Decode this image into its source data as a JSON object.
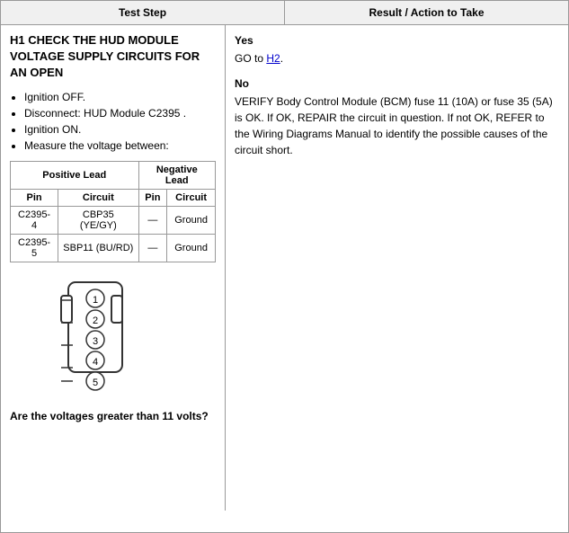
{
  "header": {
    "col1": "Test Step",
    "col2": "Result / Action to Take"
  },
  "step": {
    "title": "H1 CHECK THE HUD MODULE VOLTAGE SUPPLY CIRCUITS FOR AN OPEN",
    "bullets": [
      "Ignition OFF.",
      "Disconnect: HUD Module C2395 .",
      "Ignition ON.",
      "Measure the voltage between:"
    ],
    "table": {
      "pos_header": "Positive Lead",
      "neg_header": "Negative Lead",
      "sub_headers": [
        "Pin",
        "Circuit",
        "Pin",
        "Circuit"
      ],
      "rows": [
        {
          "pin1": "C2395-4",
          "circuit1": "CBP35 (YE/GY)",
          "pin2": "—",
          "circuit2": "Ground"
        },
        {
          "pin1": "C2395-5",
          "circuit1": "SBP11 (BU/RD)",
          "pin2": "—",
          "circuit2": "Ground"
        }
      ]
    },
    "question": "Are the voltages greater than 11 volts?"
  },
  "result": {
    "yes_label": "Yes",
    "yes_text": "GO to H2.",
    "yes_link": "H2",
    "no_label": "No",
    "no_text": "VERIFY Body Control Module (BCM) fuse 11 (10A) or fuse 35 (5A) is OK. If OK, REPAIR the circuit in question. If not OK, REFER to the Wiring Diagrams Manual to identify the possible causes of the circuit short."
  }
}
